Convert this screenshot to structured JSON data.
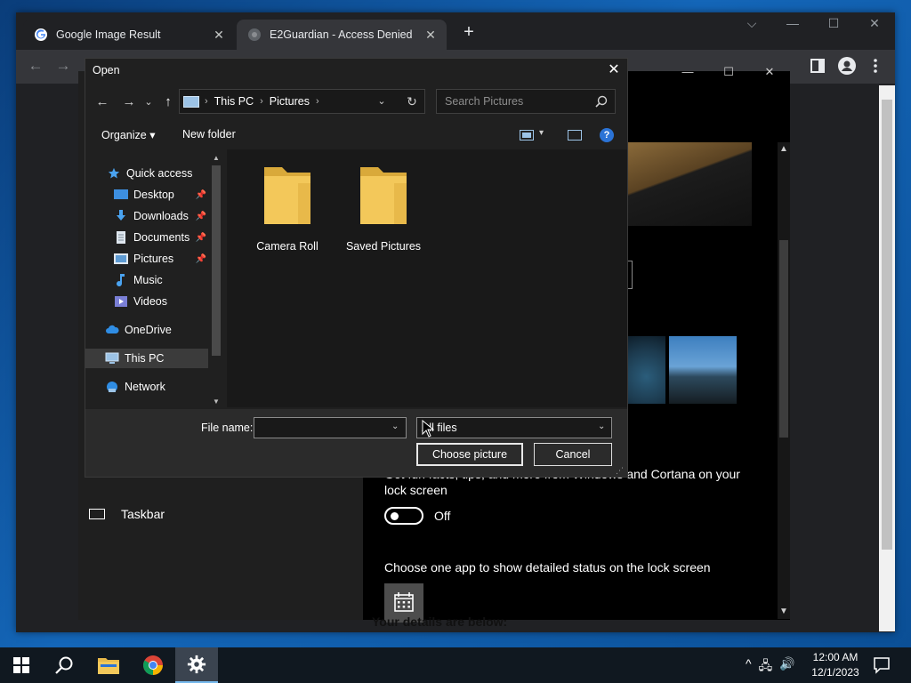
{
  "browser": {
    "tabs": [
      {
        "title": "Google Image Result",
        "active": false
      },
      {
        "title": "E2Guardian - Access Denied",
        "active": true
      }
    ],
    "new_tab_label": "+",
    "window_controls": {
      "tab_search": "⌵",
      "minimize": "—",
      "maximize": "☐",
      "close": "✕"
    },
    "nav": {
      "back": "←",
      "forward": "→"
    }
  },
  "settings_window": {
    "controls": {
      "minimize": "—",
      "maximize": "☐",
      "close": "✕"
    },
    "left_item": "Taskbar",
    "lock_screen_description": "Get fun facts, tips, and more from Windows and Cortana on your lock screen",
    "toggle_state": "Off",
    "choose_app_text": "Choose one app to show detailed status on the lock screen",
    "details_text": "Your details are below:"
  },
  "dialog": {
    "title": "Open",
    "close": "✕",
    "nav": {
      "back": "←",
      "forward": "→",
      "recent": "⌄",
      "up": "↑"
    },
    "address": {
      "root": "This PC",
      "folder": "Pictures",
      "sep": "›",
      "dropdown": "⌄",
      "refresh": "↻"
    },
    "search_placeholder": "Search Pictures",
    "toolbar": {
      "organize": "Organize ▾",
      "new_folder": "New folder",
      "view_dropdown": "▾",
      "help": "?"
    },
    "nav_pane": {
      "quick_access": "Quick access",
      "items": [
        {
          "label": "Desktop",
          "pinned": true
        },
        {
          "label": "Downloads",
          "pinned": true
        },
        {
          "label": "Documents",
          "pinned": true
        },
        {
          "label": "Pictures",
          "pinned": true
        },
        {
          "label": "Music",
          "pinned": false
        },
        {
          "label": "Videos",
          "pinned": false
        }
      ],
      "onedrive": "OneDrive",
      "this_pc": "This PC",
      "network": "Network",
      "pin_glyph": "📌"
    },
    "folders": [
      "Camera Roll",
      "Saved Pictures"
    ],
    "file_name_label": "File name:",
    "file_name_value": "",
    "file_type": "All files",
    "dropdown_glyph": "⌄",
    "choose_button": "Choose picture",
    "cancel_button": "Cancel",
    "grip": "⋰"
  },
  "taskbar": {
    "time": "12:00 AM",
    "date": "12/1/2023",
    "tray": {
      "chevron": "^",
      "network": "🖧",
      "volume": "🔊"
    }
  },
  "colors": {
    "accent": "#76b9ed",
    "folder": "#f3c85a",
    "help": "#2b73d6"
  }
}
